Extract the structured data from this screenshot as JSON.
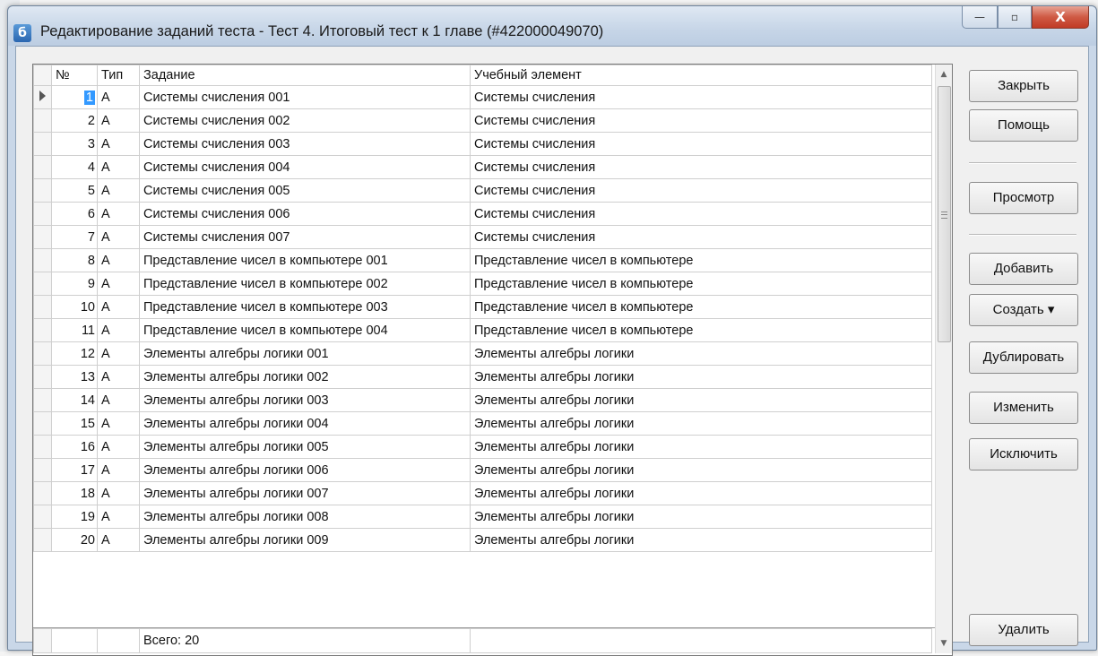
{
  "window": {
    "title": "Редактирование заданий теста - Тест 4. Итоговый тест к 1 главе (#422000049070)",
    "app_icon_glyph": "б",
    "caption": {
      "minimize": "—",
      "maximize": "▫",
      "close": "X"
    }
  },
  "grid": {
    "headers": {
      "num": "№",
      "type": "Тип",
      "task": "Задание",
      "element": "Учебный элемент"
    },
    "rows": [
      {
        "num": "1",
        "type": "А",
        "task": "Системы счисления 001",
        "element": "Системы счисления"
      },
      {
        "num": "2",
        "type": "А",
        "task": "Системы счисления 002",
        "element": "Системы счисления"
      },
      {
        "num": "3",
        "type": "А",
        "task": "Системы счисления 003",
        "element": "Системы счисления"
      },
      {
        "num": "4",
        "type": "А",
        "task": "Системы счисления 004",
        "element": "Системы счисления"
      },
      {
        "num": "5",
        "type": "А",
        "task": "Системы счисления 005",
        "element": "Системы счисления"
      },
      {
        "num": "6",
        "type": "А",
        "task": "Системы счисления 006",
        "element": "Системы счисления"
      },
      {
        "num": "7",
        "type": "А",
        "task": "Системы счисления 007",
        "element": "Системы счисления"
      },
      {
        "num": "8",
        "type": "А",
        "task": "Представление чисел в компьютере 001",
        "element": "Представление чисел в компьютере"
      },
      {
        "num": "9",
        "type": "А",
        "task": "Представление чисел в компьютере 002",
        "element": "Представление чисел в компьютере"
      },
      {
        "num": "10",
        "type": "А",
        "task": "Представление чисел в компьютере 003",
        "element": "Представление чисел в компьютере"
      },
      {
        "num": "11",
        "type": "А",
        "task": "Представление чисел в компьютере 004",
        "element": "Представление чисел в компьютере"
      },
      {
        "num": "12",
        "type": "А",
        "task": "Элементы алгебры логики 001",
        "element": "Элементы алгебры логики"
      },
      {
        "num": "13",
        "type": "А",
        "task": "Элементы алгебры логики 002",
        "element": "Элементы алгебры логики"
      },
      {
        "num": "14",
        "type": "А",
        "task": "Элементы алгебры логики 003",
        "element": "Элементы алгебры логики"
      },
      {
        "num": "15",
        "type": "А",
        "task": "Элементы алгебры логики 004",
        "element": "Элементы алгебры логики"
      },
      {
        "num": "16",
        "type": "А",
        "task": "Элементы алгебры логики 005",
        "element": "Элементы алгебры логики"
      },
      {
        "num": "17",
        "type": "А",
        "task": "Элементы алгебры логики 006",
        "element": "Элементы алгебры логики"
      },
      {
        "num": "18",
        "type": "А",
        "task": "Элементы алгебры логики 007",
        "element": "Элементы алгебры логики"
      },
      {
        "num": "19",
        "type": "А",
        "task": "Элементы алгебры логики 008",
        "element": "Элементы алгебры логики"
      },
      {
        "num": "20",
        "type": "А",
        "task": "Элементы алгебры логики 009",
        "element": "Элементы алгебры логики"
      }
    ],
    "selected_row": 1,
    "footer_total": "Всего: 20",
    "scroll_up_glyph": "▲",
    "scroll_down_glyph": "▼"
  },
  "buttons": {
    "close": "Закрыть",
    "help": "Помощь",
    "preview": "Просмотр",
    "add": "Добавить",
    "create": "Создать ▾",
    "duplicate": "Дублировать",
    "edit": "Изменить",
    "exclude": "Исключить",
    "delete": "Удалить"
  }
}
